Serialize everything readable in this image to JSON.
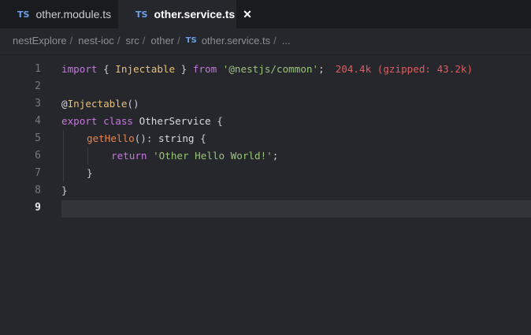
{
  "tabs": [
    {
      "badge": "TS",
      "label": "other.module.ts",
      "active": false
    },
    {
      "badge": "TS",
      "label": "other.service.ts",
      "active": true,
      "close": "✕"
    }
  ],
  "breadcrumb": {
    "items": [
      "nestExplore",
      "nest-ioc",
      "src",
      "other"
    ],
    "file_badge": "TS",
    "file": "other.service.ts",
    "ellipsis": "...",
    "separator": "/"
  },
  "editor": {
    "line_numbers": [
      "1",
      "2",
      "3",
      "4",
      "5",
      "6",
      "7",
      "8",
      "9"
    ],
    "current_line": "9",
    "lines": {
      "l1": {
        "t1": "import",
        "t2": " { ",
        "t3": "Injectable",
        "t4": " } ",
        "t5": "from",
        "t6": " ",
        "t7": "'@nestjs/common'",
        "t8": ";",
        "size": "204.4k (gzipped: 43.2k)"
      },
      "l3": {
        "t1": "@",
        "t2": "Injectable",
        "t3": "()"
      },
      "l4": {
        "t1": "export",
        "t2": " ",
        "t3": "class",
        "t4": " ",
        "t5": "OtherService",
        "t6": " {"
      },
      "l5": {
        "t1": "getHello",
        "t2": "(): ",
        "t3": "string",
        "t4": " {"
      },
      "l6": {
        "t1": "return",
        "t2": " ",
        "t3": "'Other Hello World!'",
        "t4": ";"
      },
      "l7": {
        "t1": "}"
      },
      "l8": {
        "t1": "}"
      }
    }
  }
}
